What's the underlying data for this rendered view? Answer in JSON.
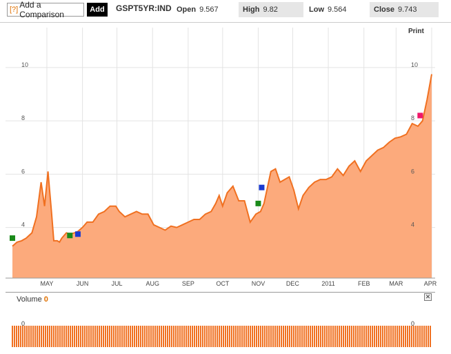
{
  "toolbar": {
    "compare_icon": "[?]",
    "compare_label": "Add a Comparison",
    "add_label": "Add",
    "symbol": "GSPT5YR:IND",
    "open_label": "Open",
    "open_value": "9.567",
    "high_label": "High",
    "high_value": "9.82",
    "low_label": "Low",
    "low_value": "9.564",
    "close_label": "Close",
    "close_value": "9.743"
  },
  "print_label": "Print",
  "volume": {
    "label": "Volume",
    "value": "0",
    "axis_left": "0",
    "axis_right": "0",
    "close_icon": "close-icon"
  },
  "colors": {
    "line": "#f07020",
    "fill": "#fcaa7c",
    "volume": "#f07020",
    "marker_green": "#1a8a1a",
    "marker_blue": "#1a3ad0",
    "marker_pink": "#f0186a"
  },
  "chart_data": {
    "type": "area",
    "ylim": [
      2.1,
      11.5
    ],
    "y_ticks": [
      "10",
      "8",
      "6",
      "4"
    ],
    "y_tick_values": [
      10,
      8,
      6,
      4
    ],
    "x_tick_labels": [
      "MAY",
      "JUN",
      "JUL",
      "AUG",
      "SEP",
      "OCT",
      "NOV",
      "DEC",
      "2011",
      "FEB",
      "MAR",
      "APR"
    ],
    "x_range": [
      "2010-04-01",
      "2011-04-01"
    ],
    "x_ticks": [
      "2010-05-01",
      "2010-06-01",
      "2010-07-01",
      "2010-08-01",
      "2010-09-01",
      "2010-10-01",
      "2010-11-01",
      "2010-12-01",
      "2011-01-01",
      "2011-02-01",
      "2011-03-01",
      "2011-04-01"
    ],
    "grid": true,
    "series": [
      {
        "x": [
          "2010-04-01",
          "2010-04-05",
          "2010-04-09",
          "2010-04-13",
          "2010-04-18",
          "2010-04-22",
          "2010-04-26",
          "2010-04-29",
          "2010-05-02",
          "2010-05-05",
          "2010-05-07",
          "2010-05-10",
          "2010-05-12",
          "2010-05-14",
          "2010-05-18",
          "2010-05-21",
          "2010-05-25",
          "2010-05-28",
          "2010-06-01",
          "2010-06-05",
          "2010-06-10",
          "2010-06-15",
          "2010-06-20",
          "2010-06-25",
          "2010-06-30",
          "2010-07-03",
          "2010-07-08",
          "2010-07-13",
          "2010-07-18",
          "2010-07-23",
          "2010-07-28",
          "2010-08-02",
          "2010-08-07",
          "2010-08-12",
          "2010-08-17",
          "2010-08-22",
          "2010-08-27",
          "2010-09-01",
          "2010-09-06",
          "2010-09-11",
          "2010-09-16",
          "2010-09-21",
          "2010-09-25",
          "2010-09-28",
          "2010-10-01",
          "2010-10-05",
          "2010-10-10",
          "2010-10-15",
          "2010-10-20",
          "2010-10-25",
          "2010-10-30",
          "2010-11-03",
          "2010-11-06",
          "2010-11-09",
          "2010-11-12",
          "2010-11-16",
          "2010-11-20",
          "2010-11-24",
          "2010-11-28",
          "2010-12-02",
          "2010-12-06",
          "2010-12-10",
          "2010-12-15",
          "2010-12-20",
          "2010-12-25",
          "2010-12-30",
          "2011-01-04",
          "2011-01-09",
          "2011-01-14",
          "2011-01-19",
          "2011-01-24",
          "2011-01-29",
          "2011-02-03",
          "2011-02-08",
          "2011-02-13",
          "2011-02-18",
          "2011-02-23",
          "2011-02-28",
          "2011-03-05",
          "2011-03-10",
          "2011-03-15",
          "2011-03-20",
          "2011-03-24",
          "2011-03-28",
          "2011-04-01"
        ],
        "values": [
          3.3,
          3.45,
          3.5,
          3.6,
          3.8,
          4.4,
          5.7,
          4.8,
          6.1,
          4.6,
          3.5,
          3.5,
          3.45,
          3.6,
          3.8,
          3.75,
          3.8,
          3.85,
          4.0,
          4.2,
          4.2,
          4.5,
          4.6,
          4.8,
          4.8,
          4.6,
          4.4,
          4.5,
          4.6,
          4.5,
          4.5,
          4.1,
          4.0,
          3.9,
          4.05,
          4.0,
          4.1,
          4.2,
          4.3,
          4.3,
          4.5,
          4.6,
          4.9,
          5.2,
          4.8,
          5.3,
          5.55,
          5.0,
          5.0,
          4.2,
          4.5,
          4.6,
          4.9,
          5.5,
          6.1,
          6.2,
          5.7,
          5.8,
          5.9,
          5.4,
          4.7,
          5.2,
          5.5,
          5.7,
          5.8,
          5.8,
          5.9,
          6.2,
          5.95,
          6.3,
          6.5,
          6.1,
          6.5,
          6.7,
          6.9,
          7.0,
          7.2,
          7.35,
          7.4,
          7.5,
          7.9,
          7.8,
          8.0,
          8.8,
          9.75
        ]
      }
    ],
    "markers": [
      {
        "x": "2010-04-01",
        "y": 3.6,
        "color": "green"
      },
      {
        "x": "2010-05-21",
        "y": 3.7,
        "color": "green"
      },
      {
        "x": "2010-05-28",
        "y": 3.75,
        "color": "blue"
      },
      {
        "x": "2010-11-01",
        "y": 4.9,
        "color": "green"
      },
      {
        "x": "2010-11-04",
        "y": 5.5,
        "color": "blue"
      },
      {
        "x": "2011-03-22",
        "y": 8.2,
        "color": "pink"
      }
    ]
  }
}
